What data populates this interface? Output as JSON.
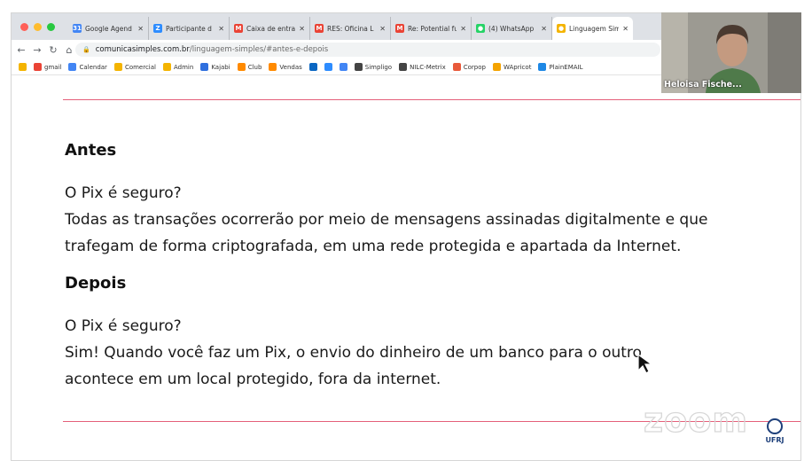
{
  "browser": {
    "tabs": [
      {
        "label": "Google Agend",
        "icon_color": "#4285f4",
        "icon": "calendar-icon",
        "glyph": "31"
      },
      {
        "label": "Participante d",
        "icon_color": "#2d8cff",
        "icon": "zoom-icon",
        "glyph": "Z"
      },
      {
        "label": "Caixa de entra",
        "icon_color": "#ea4335",
        "icon": "gmail-icon",
        "glyph": "M"
      },
      {
        "label": "RES: Oficina L",
        "icon_color": "#ea4335",
        "icon": "gmail-icon",
        "glyph": "M"
      },
      {
        "label": "Re: Potential fu",
        "icon_color": "#ea4335",
        "icon": "gmail-icon",
        "glyph": "M"
      },
      {
        "label": "(4) WhatsApp",
        "icon_color": "#25d366",
        "icon": "whatsapp-icon",
        "glyph": "●"
      },
      {
        "label": "Linguagem Sim",
        "icon_color": "#f4b400",
        "icon": "site-icon",
        "glyph": "●",
        "active": true
      }
    ],
    "url_host": "comunicasimples.com.br",
    "url_path": "/linguagem-simples/#antes-e-depois",
    "bookmarks": [
      {
        "label": "",
        "color": "#f4b400",
        "icon": "star-icon"
      },
      {
        "label": "gmail",
        "color": "#ea4335",
        "icon": "gmail-icon"
      },
      {
        "label": "Calendar",
        "color": "#4285f4",
        "icon": "calendar-icon"
      },
      {
        "label": "Comercial",
        "color": "#f4b400",
        "icon": "folder-icon"
      },
      {
        "label": "Admin",
        "color": "#f4b400",
        "icon": "site-icon"
      },
      {
        "label": "Kajabi",
        "color": "#2f6fde",
        "icon": "kajabi-icon"
      },
      {
        "label": "Club",
        "color": "#ff8a00",
        "icon": "flame-icon"
      },
      {
        "label": "Vendas",
        "color": "#ff8a00",
        "icon": "flame-icon"
      },
      {
        "label": "",
        "color": "#0a66c2",
        "icon": "linkedin-icon"
      },
      {
        "label": "",
        "color": "#2d8cff",
        "icon": "tool-icon"
      },
      {
        "label": "",
        "color": "#4285f4",
        "icon": "translate-icon"
      },
      {
        "label": "Simpligo",
        "color": "#444444",
        "icon": "globe-icon"
      },
      {
        "label": "NILC-Metrix",
        "color": "#444444",
        "icon": "globe-icon"
      },
      {
        "label": "Corpop",
        "color": "#e8593a",
        "icon": "corpop-icon"
      },
      {
        "label": "WApricot",
        "color": "#f4a300",
        "icon": "apricot-icon"
      },
      {
        "label": "PlainEMAIL",
        "color": "#1e88e5",
        "icon": "email-icon"
      }
    ]
  },
  "slide": {
    "before_heading": "Antes",
    "before_lines": [
      "O Pix é seguro?",
      "Todas as transações ocorrerão por meio de mensagens assinadas digitalmente e que",
      "trafegam  de forma criptografada, em uma rede protegida e apartada da Internet."
    ],
    "after_heading": "Depois",
    "after_lines": [
      "O Pix é seguro?",
      "Sim! Quando você faz um Pix, o envio do dinheiro de um banco para o outro",
      "acontece em um local protegido, fora da internet."
    ],
    "accent_color": "#e4607a"
  },
  "overlay": {
    "zoom_watermark": "zoom",
    "ufrj_label": "UFRJ",
    "participant_name": "Heloisa Fische..."
  }
}
